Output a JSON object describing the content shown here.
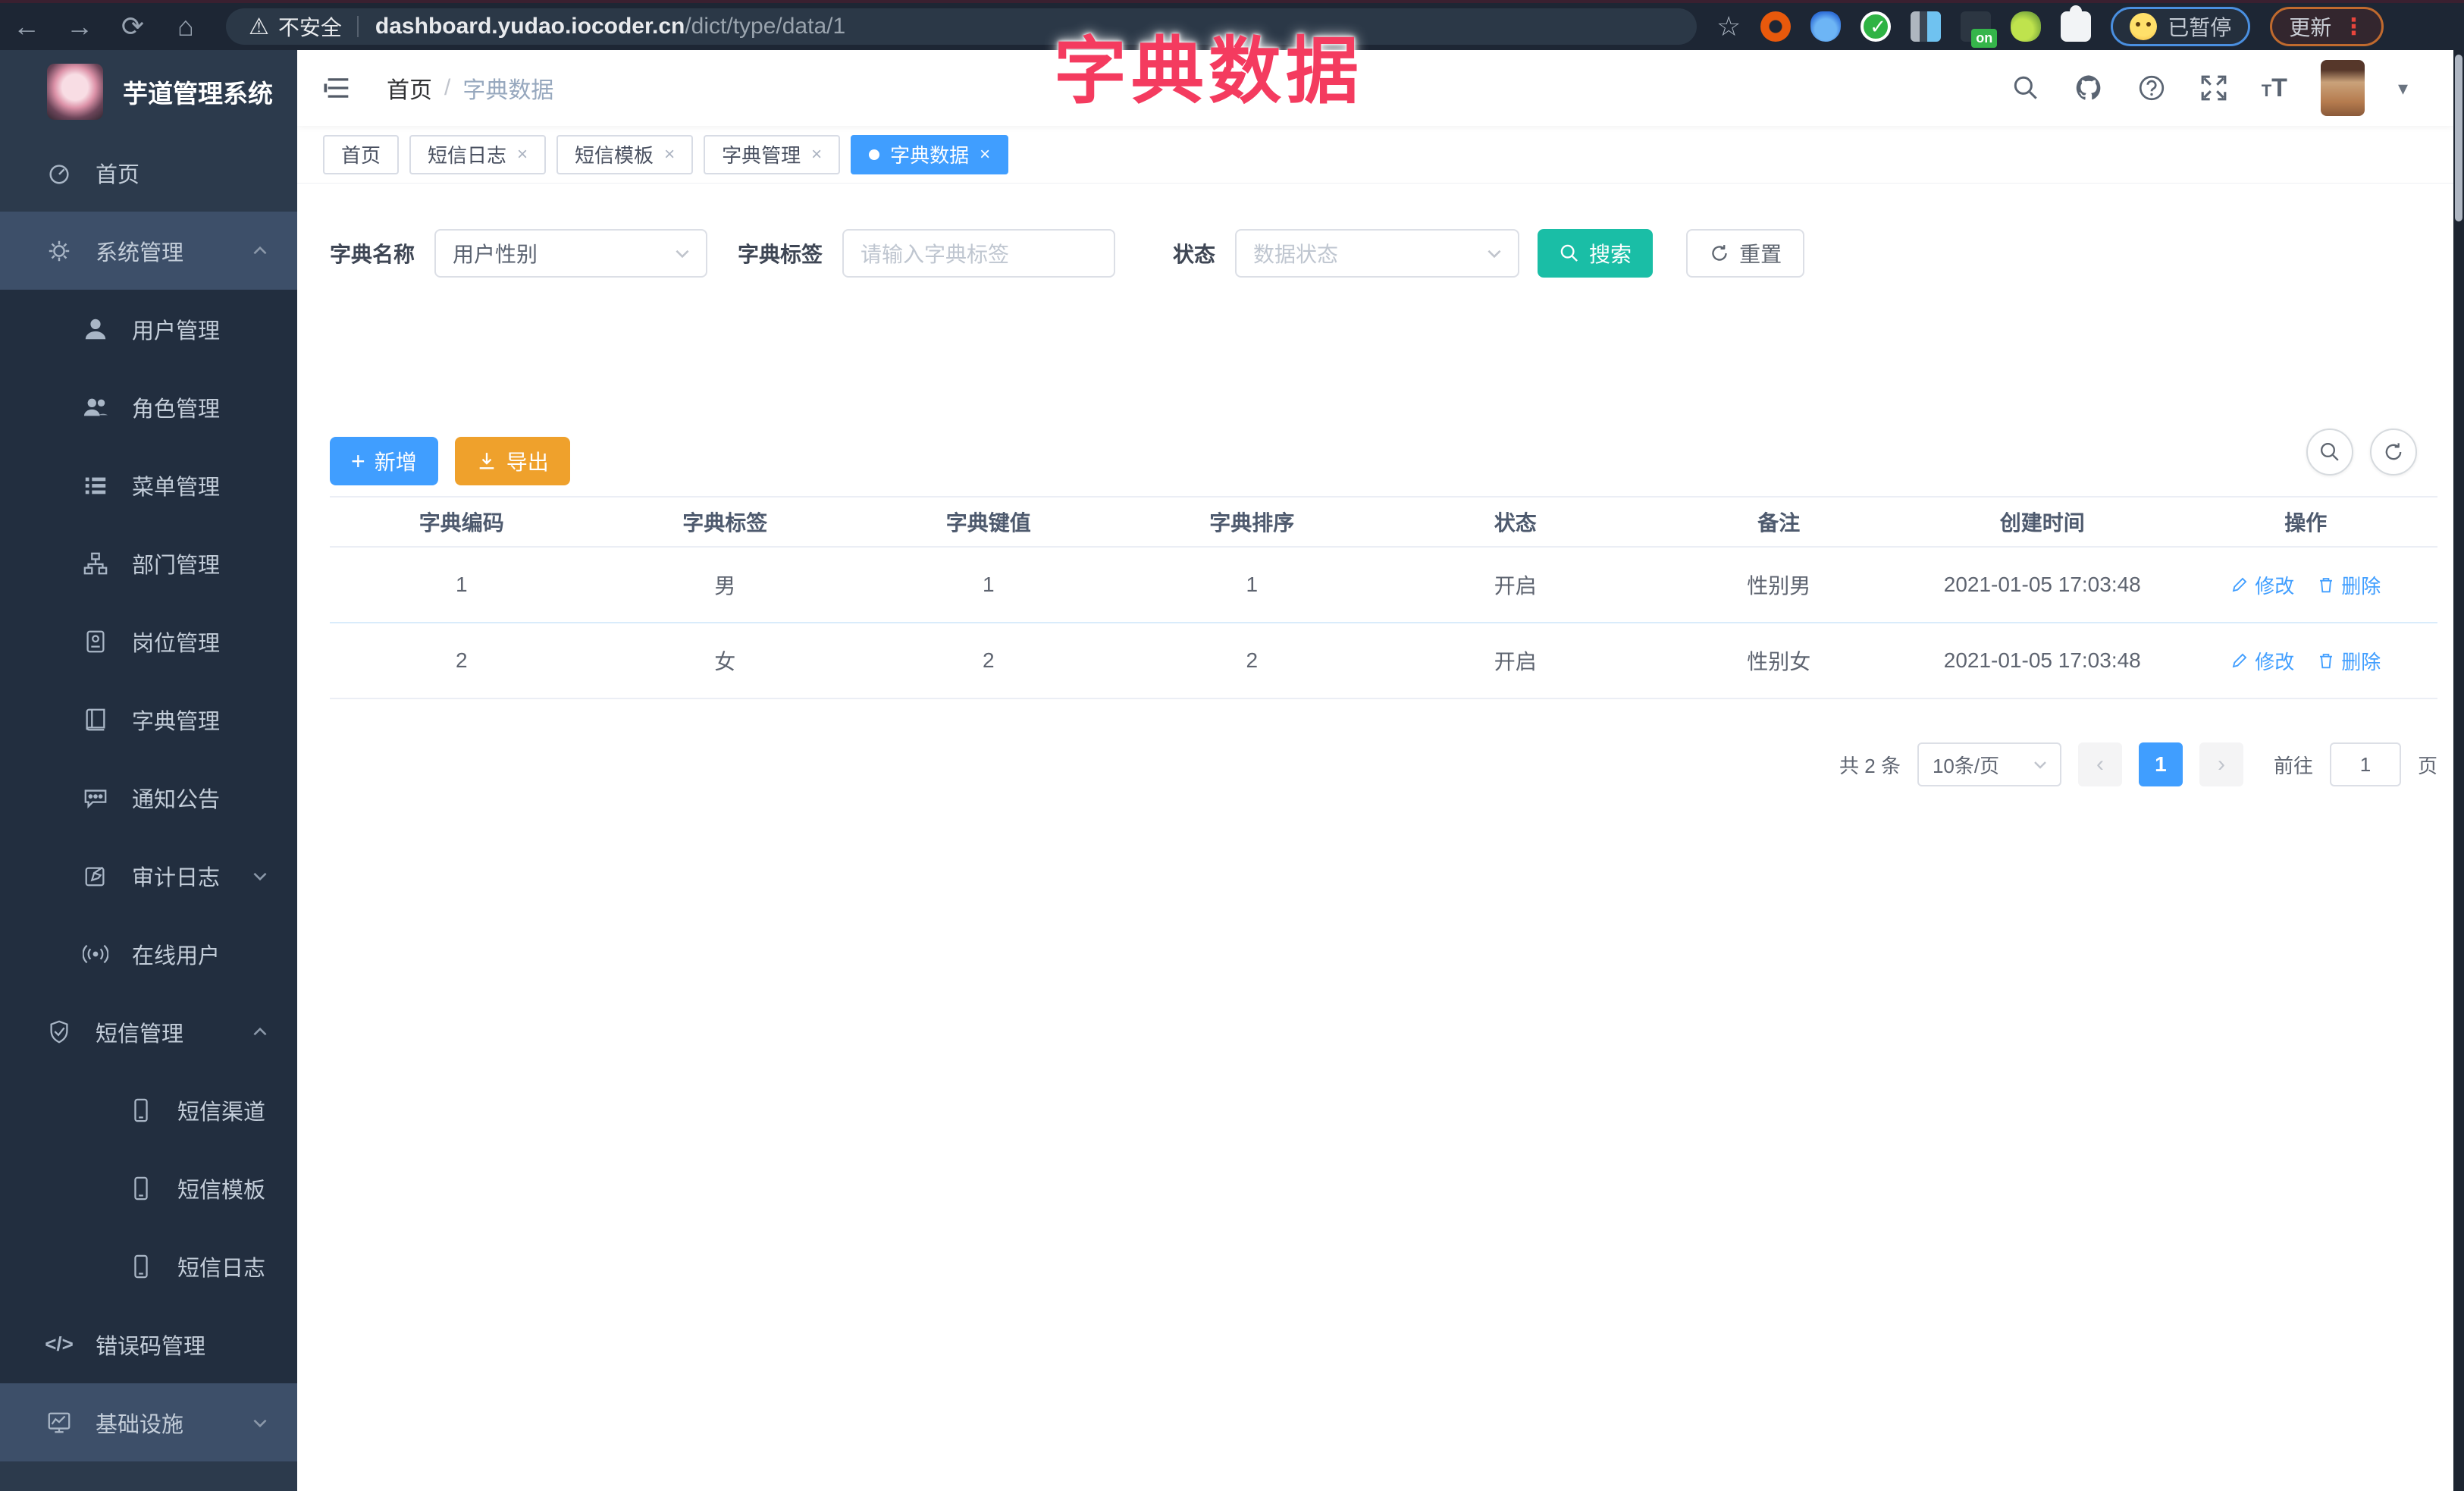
{
  "overlay_title": "字典数据",
  "browser": {
    "security_label": "不安全",
    "url_host": "dashboard.yudao.iocoder.cn",
    "url_path": "/dict/type/data/1",
    "on_badge": "on",
    "paused_label": "已暂停",
    "update_label": "更新"
  },
  "sidebar": {
    "logo_title": "芋道管理系统",
    "items": [
      {
        "label": "首页"
      },
      {
        "label": "系统管理"
      },
      {
        "label": "用户管理"
      },
      {
        "label": "角色管理"
      },
      {
        "label": "菜单管理"
      },
      {
        "label": "部门管理"
      },
      {
        "label": "岗位管理"
      },
      {
        "label": "字典管理"
      },
      {
        "label": "通知公告"
      },
      {
        "label": "审计日志"
      },
      {
        "label": "在线用户"
      },
      {
        "label": "短信管理"
      },
      {
        "label": "短信渠道"
      },
      {
        "label": "短信模板"
      },
      {
        "label": "短信日志"
      },
      {
        "label": "错误码管理"
      },
      {
        "label": "基础设施"
      }
    ]
  },
  "header": {
    "breadcrumb_home": "首页",
    "breadcrumb_sep": "/",
    "breadcrumb_current": "字典数据"
  },
  "tabs": [
    {
      "label": "首页"
    },
    {
      "label": "短信日志"
    },
    {
      "label": "短信模板"
    },
    {
      "label": "字典管理"
    },
    {
      "label": "字典数据"
    }
  ],
  "filters": {
    "name_label": "字典名称",
    "name_value": "用户性别",
    "tag_label": "字典标签",
    "tag_placeholder": "请输入字典标签",
    "status_label": "状态",
    "status_placeholder": "数据状态",
    "search_label": "搜索",
    "reset_label": "重置"
  },
  "toolbar": {
    "add_label": "新增",
    "export_label": "导出"
  },
  "table": {
    "columns": [
      "字典编码",
      "字典标签",
      "字典键值",
      "字典排序",
      "状态",
      "备注",
      "创建时间",
      "操作"
    ],
    "rows": [
      {
        "code": "1",
        "label": "男",
        "value": "1",
        "sort": "1",
        "status": "开启",
        "remark": "性别男",
        "created": "2021-01-05 17:03:48"
      },
      {
        "code": "2",
        "label": "女",
        "value": "2",
        "sort": "2",
        "status": "开启",
        "remark": "性别女",
        "created": "2021-01-05 17:03:48"
      }
    ],
    "edit_label": "修改",
    "delete_label": "删除"
  },
  "pagination": {
    "total_text": "共 2 条",
    "page_size": "10条/页",
    "current_page": "1",
    "goto_label": "前往",
    "goto_value": "1",
    "page_unit": "页"
  },
  "colors": {
    "primary": "#409eff",
    "warning": "#efa12c",
    "search_teal": "#1abea6",
    "title_pink": "#f43b5f",
    "sidebar_bg": "#2c3a4c",
    "sidebar_submenu_bg": "#222e3f",
    "sidebar_highlight_bg": "#3d4f69",
    "chrome_bg": "#1d2634"
  }
}
